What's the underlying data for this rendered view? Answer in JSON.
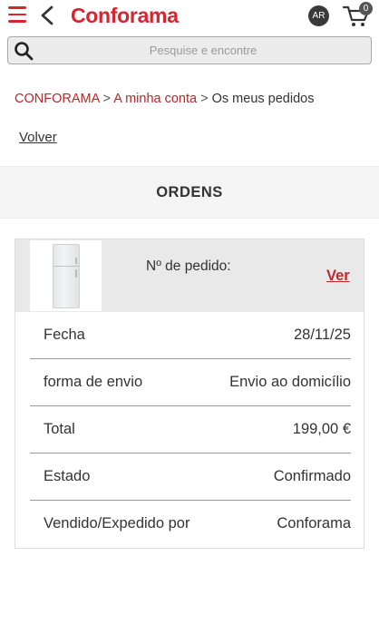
{
  "header": {
    "logo": "Conforama",
    "avatar_initials": "AR",
    "cart_count": "0",
    "brand_color": "#d6252f"
  },
  "search": {
    "placeholder": "Pesquise e encontre"
  },
  "breadcrumb": {
    "home": "CONFORAMA",
    "account": "A minha conta",
    "current": "Os meus pedidos",
    "separator": ">"
  },
  "back_link": "Volver",
  "section": {
    "title": "ORDENS"
  },
  "order": {
    "order_number_label": "Nº de pedido:",
    "view_label": "Ver",
    "rows": [
      {
        "label": "Fecha",
        "value": "28/11/25"
      },
      {
        "label": "forma de envio",
        "value": "Envio ao domicílio"
      },
      {
        "label": "Total",
        "value": "199,00 €"
      },
      {
        "label": "Estado",
        "value": "Confirmado"
      },
      {
        "label": "Vendido/Expedido por",
        "value": "Conforama"
      }
    ]
  },
  "icons": [
    "menu-icon",
    "back-chevron-icon",
    "avatar",
    "cart-icon",
    "search-icon"
  ]
}
